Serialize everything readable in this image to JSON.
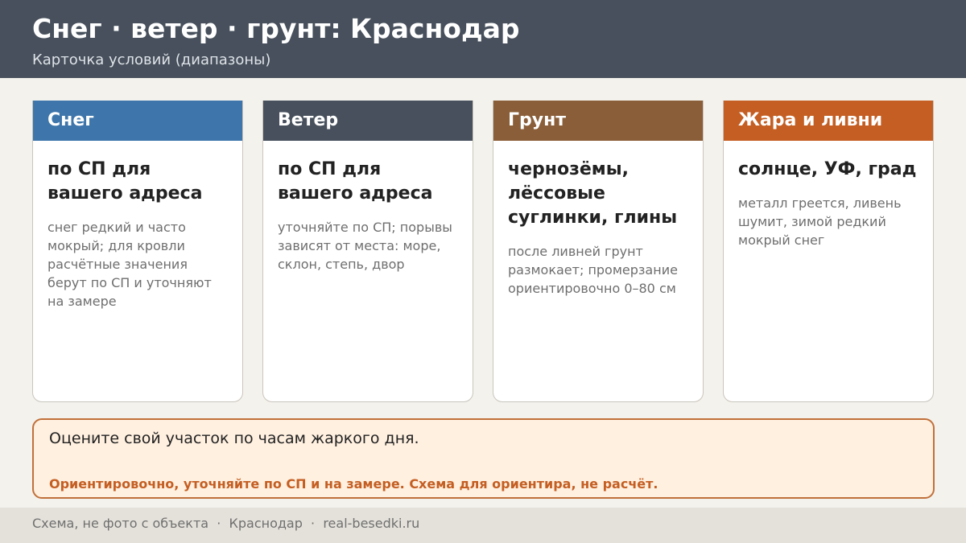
{
  "header": {
    "title": "Снег · ветер · грунт: Краснодар",
    "subtitle": "Карточка условий (диапазоны)"
  },
  "cards": [
    {
      "title": "Снег",
      "main": "по СП для вашего адреса",
      "note": "снег редкий и часто мокрый; для кровли расчётные значения берут по СП и уточняют на замере",
      "color": "#3e76ab"
    },
    {
      "title": "Ветер",
      "main": "по СП для вашего адреса",
      "note": "уточняйте по СП; порывы зависят от места: море, склон, степь, двор",
      "color": "#47505c"
    },
    {
      "title": "Грунт",
      "main": "чернозёмы, лёссовые суглинки, глины",
      "note": "после ливней грунт размокает; промерзание ориентировочно 0–80 см",
      "color": "#8a5e38"
    },
    {
      "title": "Жара и ливни",
      "main": "солнце, УФ, град",
      "note": "металл греется, ливень шумит, зимой редкий мокрый снег",
      "color": "#c45e22"
    }
  ],
  "note": {
    "main": "Оцените свой участок по часам жаркого дня.",
    "warning": "Ориентировочно, уточняйте по СП и на замере. Схема для ориентира, не расчёт."
  },
  "footer": {
    "text": "Схема, не фото с объекта  ·  Краснодар  ·  real-besedki.ru"
  }
}
